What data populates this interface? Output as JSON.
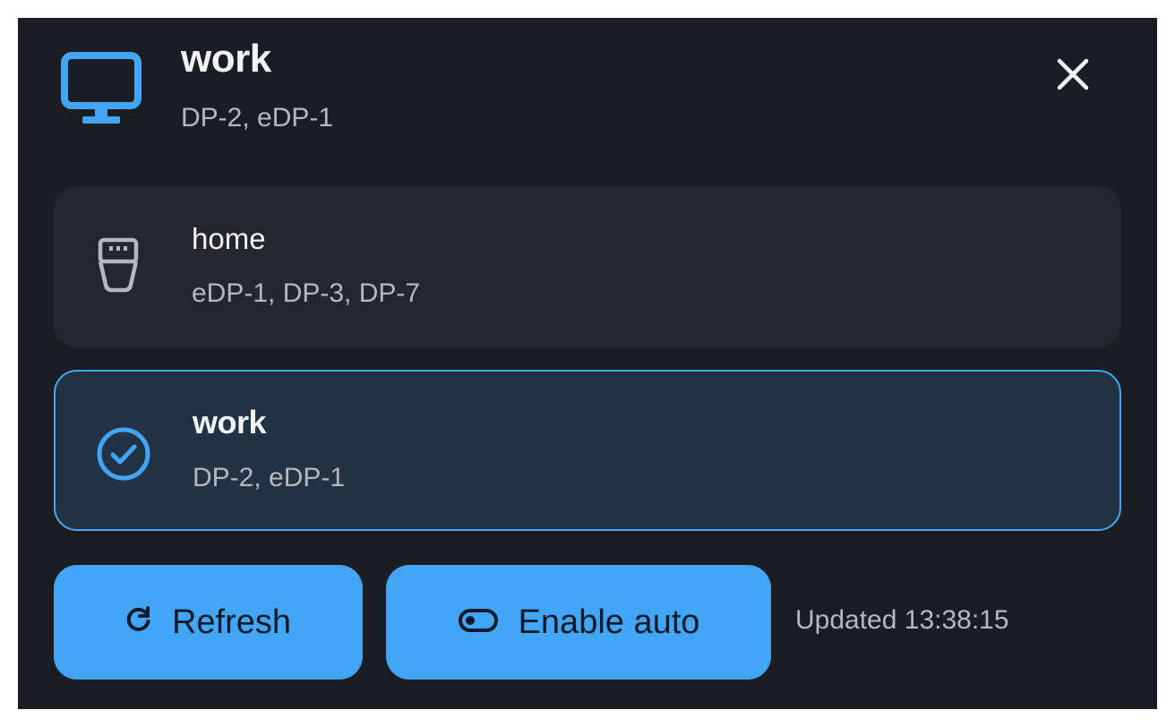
{
  "header": {
    "icon": "monitor-icon",
    "title": "work",
    "subtitle": "DP-2, eDP-1",
    "close_icon": "close-icon"
  },
  "profiles": [
    {
      "name": "home",
      "outputs": "eDP-1, DP-3, DP-7",
      "icon": "plug-icon",
      "active": false
    },
    {
      "name": "work",
      "outputs": "DP-2, eDP-1",
      "icon": "check-circle-icon",
      "active": true
    }
  ],
  "footer": {
    "refresh_label": "Refresh",
    "refresh_icon": "refresh-icon",
    "auto_label": "Enable auto",
    "auto_icon": "toggle-icon",
    "updated_text": "Updated 13:38:15"
  },
  "colors": {
    "panel_bg": "#1b1d22",
    "card_bg": "#25272c",
    "active_card_bg": "#233244",
    "accent": "#42a5f5",
    "text_primary": "#f2f3f5",
    "text_secondary": "#b5b8be"
  }
}
